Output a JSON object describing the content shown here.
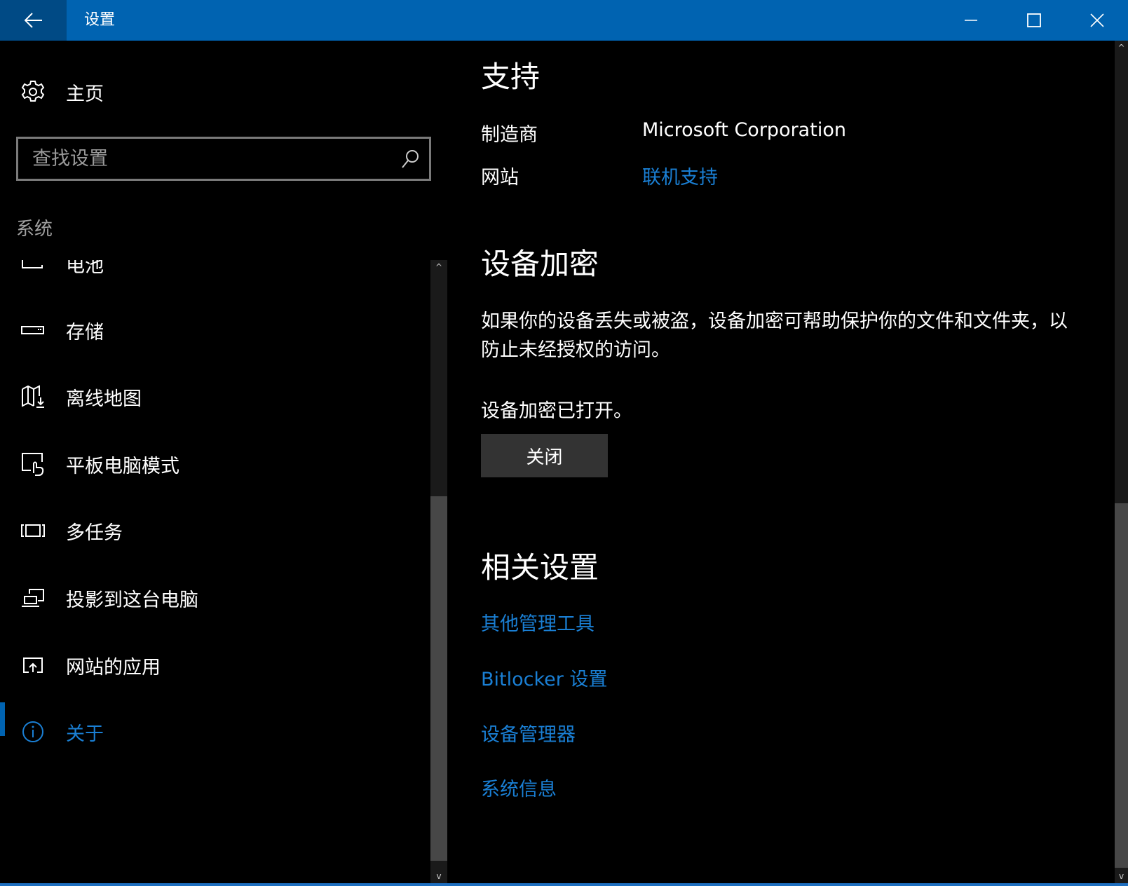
{
  "titlebar": {
    "title": "设置",
    "back_icon": "arrow-left-icon",
    "minimize_icon": "minimize-icon",
    "maximize_icon": "maximize-icon",
    "close_icon": "close-icon",
    "color": "#0063b1"
  },
  "sidebar": {
    "home_label": "主页",
    "search_placeholder": "查找设置",
    "section_label": "系统",
    "items": [
      {
        "label": "电池",
        "icon": "battery-icon"
      },
      {
        "label": "存储",
        "icon": "storage-icon"
      },
      {
        "label": "离线地图",
        "icon": "offline-map-icon"
      },
      {
        "label": "平板电脑模式",
        "icon": "tablet-mode-icon"
      },
      {
        "label": "多任务",
        "icon": "multitasking-icon"
      },
      {
        "label": "投影到这台电脑",
        "icon": "project-icon"
      },
      {
        "label": "网站的应用",
        "icon": "apps-for-websites-icon"
      },
      {
        "label": "关于",
        "icon": "info-icon",
        "active": true
      }
    ]
  },
  "main": {
    "support": {
      "heading": "支持",
      "manufacturer_label": "制造商",
      "manufacturer_value": "Microsoft Corporation",
      "website_label": "网站",
      "website_link": "联机支持"
    },
    "encryption": {
      "heading": "设备加密",
      "description": "如果你的设备丢失或被盗，设备加密可帮助保护你的文件和文件夹，以防止未经授权的访问。",
      "status": "设备加密已打开。",
      "button": "关闭"
    },
    "related": {
      "heading": "相关设置",
      "links": [
        "其他管理工具",
        "Bitlocker 设置",
        "设备管理器",
        "系统信息"
      ]
    }
  },
  "colors": {
    "accent": "#0063b1",
    "link": "#1a7fd4",
    "button": "#333333"
  }
}
